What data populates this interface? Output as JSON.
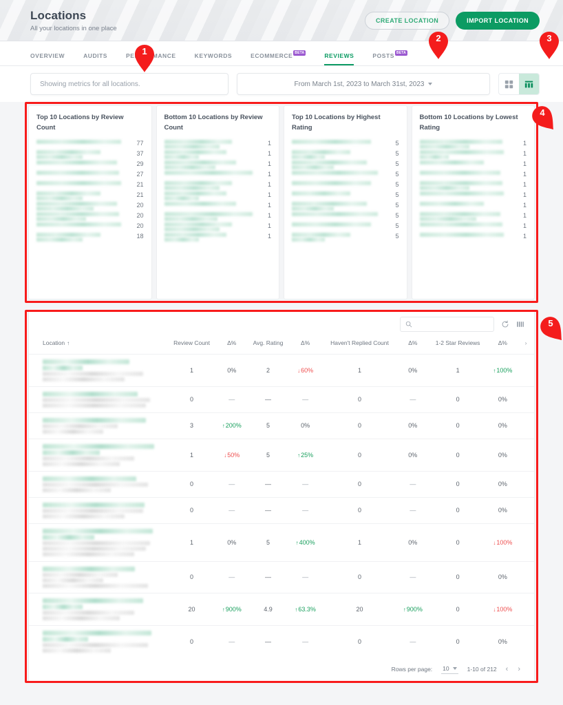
{
  "header": {
    "title": "Locations",
    "subtitle": "All your locations in one place",
    "create_label": "CREATE LOCATION",
    "import_label": "IMPORT LOCATION"
  },
  "tabs": [
    {
      "label": "OVERVIEW",
      "beta": "",
      "active": false
    },
    {
      "label": "AUDITS",
      "beta": "",
      "active": false
    },
    {
      "label": "PERFORMANCE",
      "beta": "",
      "active": false
    },
    {
      "label": "KEYWORDS",
      "beta": "",
      "active": false
    },
    {
      "label": "ECOMMERCE",
      "beta": "BETA",
      "active": false
    },
    {
      "label": "REVIEWS",
      "beta": "",
      "active": true
    },
    {
      "label": "POSTS",
      "beta": "BETA",
      "active": false
    }
  ],
  "filters": {
    "locations_text": "Showing metrics for all locations.",
    "date_range": "From March 1st, 2023 to March 31st, 2023",
    "view_grid_icon": "grid-view-icon",
    "view_table_icon": "table-view-icon",
    "active_view": "table"
  },
  "chart_data": [
    {
      "type": "bar",
      "title": "Top 10 Locations by Review Count",
      "xlabel": "",
      "ylabel": "",
      "categories": [
        "(redacted)",
        "(redacted)",
        "(redacted)",
        "(redacted)",
        "(redacted)",
        "(redacted)",
        "(redacted)",
        "(redacted)",
        "(redacted)",
        "(redacted)"
      ],
      "values": [
        77,
        37,
        29,
        27,
        21,
        21,
        20,
        20,
        20,
        18
      ],
      "labels": [
        "77",
        "37",
        "29",
        "27",
        "21",
        "21",
        "20",
        "20",
        "20",
        "18"
      ],
      "name_lines": [
        1,
        2,
        1,
        1,
        1,
        2,
        2,
        2,
        1,
        2
      ]
    },
    {
      "type": "bar",
      "title": "Bottom 10 Locations by Review Count",
      "xlabel": "",
      "ylabel": "",
      "categories": [
        "(redacted)",
        "(redacted)",
        "(redacted)",
        "(redacted)",
        "(redacted)",
        "(redacted)",
        "(redacted)",
        "(redacted)",
        "(redacted)",
        "(redacted)"
      ],
      "values": [
        1,
        1,
        1,
        1,
        1,
        1,
        1,
        1,
        1,
        1
      ],
      "labels": [
        "1",
        "1",
        "1",
        "1",
        "1",
        "1",
        "1",
        "1",
        "1",
        "1"
      ],
      "name_lines": [
        2,
        2,
        2,
        1,
        2,
        2,
        1,
        2,
        2,
        2
      ]
    },
    {
      "type": "bar",
      "title": "Top 10 Locations by Highest Rating",
      "xlabel": "",
      "ylabel": "",
      "categories": [
        "(redacted)",
        "(redacted)",
        "(redacted)",
        "(redacted)",
        "(redacted)",
        "(redacted)",
        "(redacted)",
        "(redacted)",
        "(redacted)",
        "(redacted)"
      ],
      "values": [
        5,
        5,
        5,
        5,
        5,
        5,
        5,
        5,
        5,
        5
      ],
      "labels": [
        "5",
        "5",
        "5",
        "5",
        "5",
        "5",
        "5",
        "5",
        "5",
        "5"
      ],
      "name_lines": [
        1,
        2,
        2,
        1,
        1,
        1,
        2,
        1,
        1,
        2
      ]
    },
    {
      "type": "bar",
      "title": "Bottom 10 Locations by Lowest Rating",
      "xlabel": "",
      "ylabel": "",
      "categories": [
        "(redacted)",
        "(redacted)",
        "(redacted)",
        "(redacted)",
        "(redacted)",
        "(redacted)",
        "(redacted)",
        "(redacted)",
        "(redacted)",
        "(redacted)"
      ],
      "values": [
        1,
        1,
        1,
        1,
        1,
        1,
        1,
        1,
        1,
        1
      ],
      "labels": [
        "1",
        "1",
        "1",
        "1",
        "1",
        "1",
        "1",
        "1",
        "1",
        "1"
      ],
      "name_lines": [
        2,
        2,
        1,
        1,
        2,
        1,
        1,
        2,
        1,
        1
      ]
    }
  ],
  "table": {
    "search_placeholder": "",
    "search_value": "",
    "refresh_icon": "refresh-icon",
    "columns_icon": "columns-settings-icon",
    "headers": [
      "Location",
      "Review Count",
      "Δ%",
      "Avg. Rating",
      "Δ%",
      "Haven't Replied Count",
      "Δ%",
      "1-2 Star Reviews",
      "Δ%",
      ""
    ],
    "sort_column": "Location",
    "sort_icon": "sort-asc-icon",
    "rows": [
      {
        "name_lines": 2,
        "addr_lines": 2,
        "review_count": "1",
        "d1": "0%",
        "d1_dir": "none",
        "avg_rating": "2",
        "d2": "60%",
        "d2_dir": "down",
        "not_replied": "1",
        "d3": "0%",
        "d3_dir": "none",
        "one_two_star": "1",
        "d4": "100%",
        "d4_dir": "up"
      },
      {
        "name_lines": 1,
        "addr_lines": 2,
        "review_count": "0",
        "d1": "—",
        "d1_dir": "dash",
        "avg_rating": "—",
        "d2": "—",
        "d2_dir": "dash",
        "not_replied": "0",
        "d3": "—",
        "d3_dir": "dash",
        "one_two_star": "0",
        "d4": "0%",
        "d4_dir": "none"
      },
      {
        "name_lines": 1,
        "addr_lines": 2,
        "review_count": "3",
        "d1": "200%",
        "d1_dir": "up",
        "avg_rating": "5",
        "d2": "0%",
        "d2_dir": "none",
        "not_replied": "0",
        "d3": "0%",
        "d3_dir": "none",
        "one_two_star": "0",
        "d4": "0%",
        "d4_dir": "none"
      },
      {
        "name_lines": 2,
        "addr_lines": 2,
        "review_count": "1",
        "d1": "50%",
        "d1_dir": "down",
        "avg_rating": "5",
        "d2": "25%",
        "d2_dir": "up",
        "not_replied": "0",
        "d3": "0%",
        "d3_dir": "none",
        "one_two_star": "0",
        "d4": "0%",
        "d4_dir": "none"
      },
      {
        "name_lines": 1,
        "addr_lines": 2,
        "review_count": "0",
        "d1": "—",
        "d1_dir": "dash",
        "avg_rating": "—",
        "d2": "—",
        "d2_dir": "dash",
        "not_replied": "0",
        "d3": "—",
        "d3_dir": "dash",
        "one_two_star": "0",
        "d4": "0%",
        "d4_dir": "none"
      },
      {
        "name_lines": 1,
        "addr_lines": 2,
        "review_count": "0",
        "d1": "—",
        "d1_dir": "dash",
        "avg_rating": "—",
        "d2": "—",
        "d2_dir": "dash",
        "not_replied": "0",
        "d3": "—",
        "d3_dir": "dash",
        "one_two_star": "0",
        "d4": "0%",
        "d4_dir": "none"
      },
      {
        "name_lines": 2,
        "addr_lines": 3,
        "review_count": "1",
        "d1": "0%",
        "d1_dir": "none",
        "avg_rating": "5",
        "d2": "400%",
        "d2_dir": "up",
        "not_replied": "1",
        "d3": "0%",
        "d3_dir": "none",
        "one_two_star": "0",
        "d4": "100%",
        "d4_dir": "down"
      },
      {
        "name_lines": 1,
        "addr_lines": 3,
        "review_count": "0",
        "d1": "—",
        "d1_dir": "dash",
        "avg_rating": "—",
        "d2": "—",
        "d2_dir": "dash",
        "not_replied": "0",
        "d3": "—",
        "d3_dir": "dash",
        "one_two_star": "0",
        "d4": "0%",
        "d4_dir": "none"
      },
      {
        "name_lines": 2,
        "addr_lines": 2,
        "review_count": "20",
        "d1": "900%",
        "d1_dir": "up",
        "avg_rating": "4.9",
        "d2": "63.3%",
        "d2_dir": "up",
        "not_replied": "20",
        "d3": "900%",
        "d3_dir": "up",
        "one_two_star": "0",
        "d4": "100%",
        "d4_dir": "down"
      },
      {
        "name_lines": 2,
        "addr_lines": 2,
        "review_count": "0",
        "d1": "—",
        "d1_dir": "dash",
        "avg_rating": "—",
        "d2": "—",
        "d2_dir": "dash",
        "not_replied": "0",
        "d3": "—",
        "d3_dir": "dash",
        "one_two_star": "0",
        "d4": "0%",
        "d4_dir": "none"
      }
    ],
    "footer": {
      "rows_per_page_label": "Rows per page:",
      "rows_per_page_value": "10",
      "range_label": "1-10 of 212",
      "prev_icon": "chevron-left-icon",
      "next_icon": "chevron-right-icon"
    }
  },
  "annotations": {
    "markers": [
      {
        "number": "1"
      },
      {
        "number": "2"
      },
      {
        "number": "3"
      },
      {
        "number": "4"
      },
      {
        "number": "5"
      }
    ],
    "accent_color": "#f81b1b"
  },
  "colors": {
    "brand_green": "#0c9b63",
    "up_green": "#1aa05e",
    "down_red": "#ee4f4f",
    "annotation_red": "#f81b1b"
  }
}
